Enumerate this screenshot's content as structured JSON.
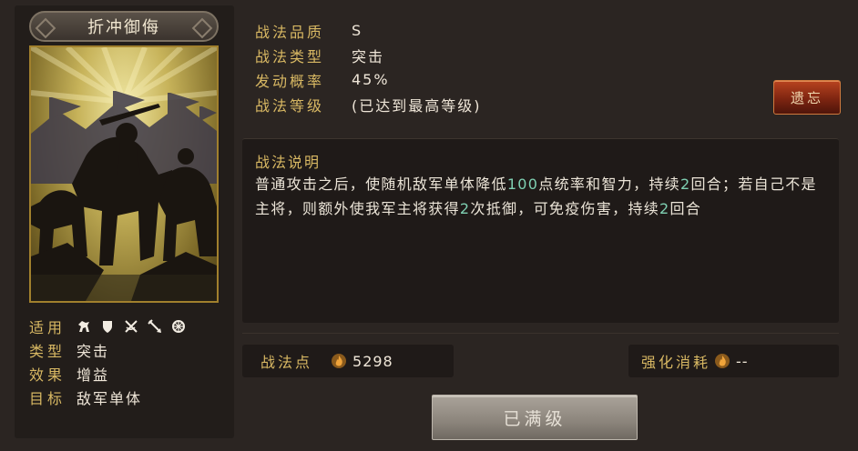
{
  "card": {
    "name": "折冲御侮"
  },
  "attributes": {
    "apply_label": "适用",
    "apply_icons": [
      "cavalry-icon",
      "shield-icon",
      "bow-icon",
      "spear-icon",
      "wheel-icon"
    ],
    "type_label": "类型",
    "type_value": "突击",
    "effect_label": "效果",
    "effect_value": "增益",
    "target_label": "目标",
    "target_value": "敌军单体"
  },
  "info": {
    "quality_label": "战法品质",
    "quality_value": "S",
    "type_label": "战法类型",
    "type_value": "突击",
    "rate_label": "发动概率",
    "rate_value": "45%",
    "level_label": "战法等级",
    "level_value": "(已达到最高等级)"
  },
  "forget_button": "遗忘",
  "description": {
    "title": "战法说明",
    "p1": "普通攻击之后，使随机敌军单体降低",
    "n1": "100",
    "p2": "点统率和智力，持续",
    "n2": "2",
    "p3": "回合；若自己不是主将，则额外使我军主将获得",
    "n3": "2",
    "p4": "次抵御，可免疫伤害，持续",
    "n4": "2",
    "p5": "回合"
  },
  "points": {
    "label": "战法点",
    "value": "5298"
  },
  "enhance": {
    "label": "强化消耗",
    "value": "--"
  },
  "max_button": "已满级",
  "colors": {
    "gold_label": "#d8b863",
    "highlight_number": "#7fd0b2",
    "forget_button_red": "#7e2511",
    "panel_dark": "#1f1a18"
  }
}
